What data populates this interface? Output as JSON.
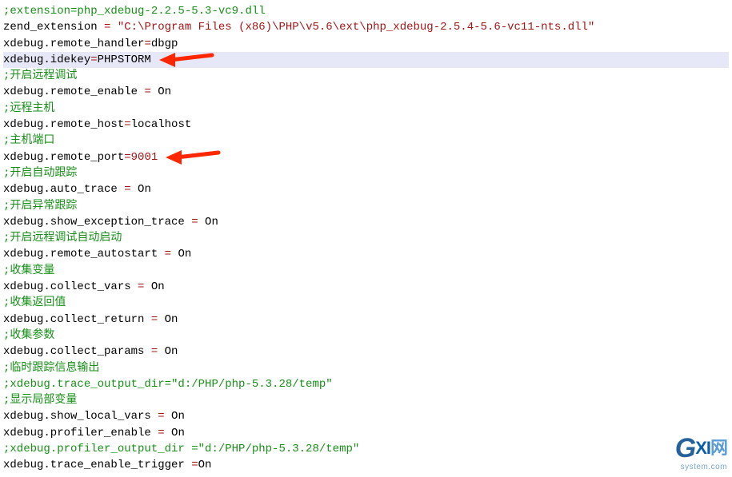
{
  "lines": [
    {
      "type": "comment",
      "text": ";extension=php_xdebug-2.2.5-5.3-vc9.dll"
    },
    {
      "type": "kv",
      "key": "zend_extension ",
      "eq": "=",
      "val": " \"C:\\Program Files (x86)\\PHP\\v5.6\\ext\\php_xdebug-2.5.4-5.6-vc11-nts.dll\""
    },
    {
      "type": "kv",
      "key": "xdebug.remote_handler",
      "eq": "=",
      "val": "dbgp",
      "valColor": "black"
    },
    {
      "type": "kv",
      "key": "xdebug.idekey",
      "eq": "=",
      "val": "PHPSTORM",
      "valColor": "black",
      "highlight": true,
      "arrow": true
    },
    {
      "type": "comment",
      "text": ";开启远程调试"
    },
    {
      "type": "kv",
      "key": "xdebug.remote_enable ",
      "eq": "=",
      "val": " On",
      "valColor": "black"
    },
    {
      "type": "comment",
      "text": ";远程主机"
    },
    {
      "type": "kv",
      "key": "xdebug.remote_host",
      "eq": "=",
      "val": "localhost",
      "valColor": "black"
    },
    {
      "type": "comment",
      "text": ";主机端口"
    },
    {
      "type": "kv",
      "key": "xdebug.remote_port",
      "eq": "=",
      "val": "9001",
      "valColor": "red",
      "arrow": true
    },
    {
      "type": "comment",
      "text": ";开启自动跟踪"
    },
    {
      "type": "kv",
      "key": "xdebug.auto_trace ",
      "eq": "=",
      "val": " On",
      "valColor": "black"
    },
    {
      "type": "comment",
      "text": ";开启异常跟踪"
    },
    {
      "type": "kv",
      "key": "xdebug.show_exception_trace ",
      "eq": "=",
      "val": " On",
      "valColor": "black"
    },
    {
      "type": "comment",
      "text": ";开启远程调试自动启动"
    },
    {
      "type": "kv",
      "key": "xdebug.remote_autostart ",
      "eq": "=",
      "val": " On",
      "valColor": "black"
    },
    {
      "type": "comment",
      "text": ";收集变量"
    },
    {
      "type": "kv",
      "key": "xdebug.collect_vars ",
      "eq": "=",
      "val": " On",
      "valColor": "black"
    },
    {
      "type": "comment",
      "text": ";收集返回值"
    },
    {
      "type": "kv",
      "key": "xdebug.collect_return ",
      "eq": "=",
      "val": " On",
      "valColor": "black"
    },
    {
      "type": "comment",
      "text": ";收集参数"
    },
    {
      "type": "kv",
      "key": "xdebug.collect_params ",
      "eq": "=",
      "val": " On",
      "valColor": "black"
    },
    {
      "type": "comment",
      "text": ";临时跟踪信息输出"
    },
    {
      "type": "comment",
      "text": ";xdebug.trace_output_dir=\"d:/PHP/php-5.3.28/temp\""
    },
    {
      "type": "comment",
      "text": ";显示局部变量"
    },
    {
      "type": "kv",
      "key": "xdebug.show_local_vars ",
      "eq": "=",
      "val": " On",
      "valColor": "black"
    },
    {
      "type": "kv",
      "key": "xdebug.profiler_enable ",
      "eq": "=",
      "val": " On",
      "valColor": "black"
    },
    {
      "type": "comment",
      "text": ";xdebug.profiler_output_dir =\"d:/PHP/php-5.3.28/temp\""
    },
    {
      "type": "kv",
      "key": "xdebug.trace_enable_trigger ",
      "eq": "=",
      "val": "On",
      "valColor": "black"
    }
  ],
  "logo": {
    "g": "G",
    "xi": "XI",
    "wang": "网",
    "sub": "system.com"
  },
  "arrow_color": "#ff2600"
}
